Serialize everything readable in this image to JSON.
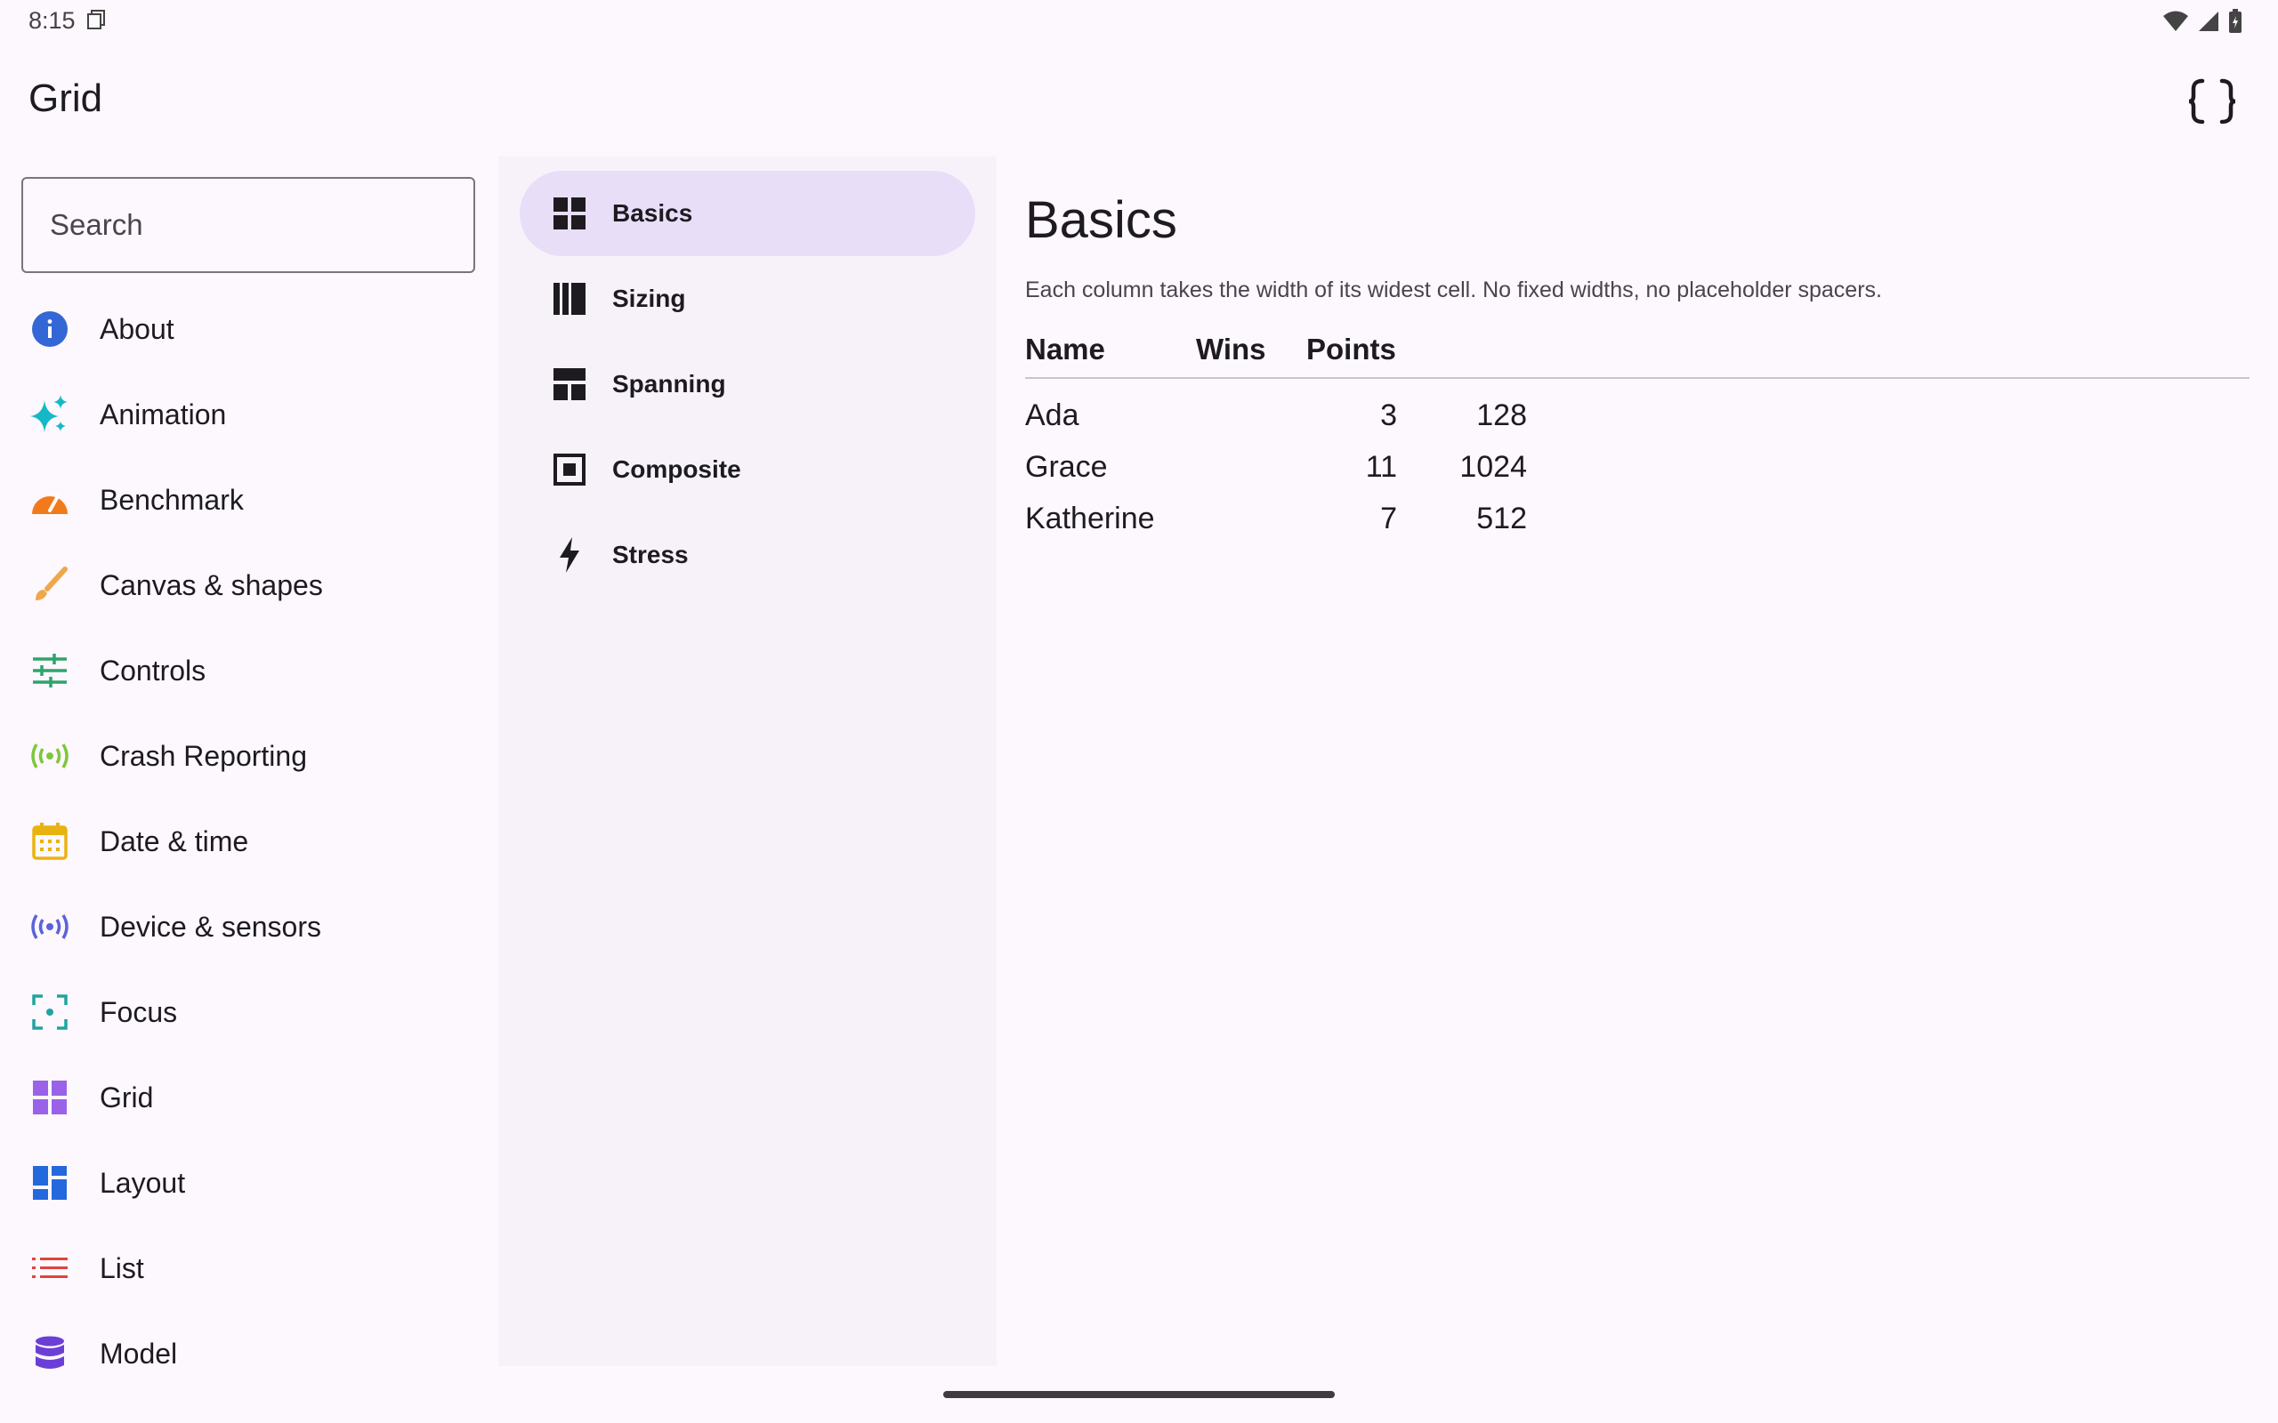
{
  "status": {
    "time": "8:15"
  },
  "app": {
    "title": "Grid"
  },
  "search": {
    "placeholder": "Search"
  },
  "nav": [
    {
      "label": "About",
      "icon": "info-icon",
      "color": "#3367d6"
    },
    {
      "label": "Animation",
      "icon": "sparkle-icon",
      "color": "#14b8c6"
    },
    {
      "label": "Benchmark",
      "icon": "speedometer-icon",
      "color": "#f27a1a"
    },
    {
      "label": "Canvas & shapes",
      "icon": "brush-icon",
      "color": "#eea84a"
    },
    {
      "label": "Controls",
      "icon": "sliders-icon",
      "color": "#2ea46b"
    },
    {
      "label": "Crash Reporting",
      "icon": "broadcast-icon",
      "color": "#7cc83a"
    },
    {
      "label": "Date & time",
      "icon": "calendar-icon",
      "color": "#e9b30f"
    },
    {
      "label": "Device & sensors",
      "icon": "sensors-icon",
      "color": "#5a63d8"
    },
    {
      "label": "Focus",
      "icon": "focus-icon",
      "color": "#1fa4a0"
    },
    {
      "label": "Grid",
      "icon": "grid-icon",
      "color": "#9a62e8"
    },
    {
      "label": "Layout",
      "icon": "dashboard-icon",
      "color": "#2468dd"
    },
    {
      "label": "List",
      "icon": "list-icon",
      "color": "#e0443a"
    },
    {
      "label": "Model",
      "icon": "database-icon",
      "color": "#6b3fd6"
    }
  ],
  "sub_nav": [
    {
      "label": "Basics",
      "icon": "grid-view-icon",
      "active": true
    },
    {
      "label": "Sizing",
      "icon": "columns-icon",
      "active": false
    },
    {
      "label": "Spanning",
      "icon": "span-layout-icon",
      "active": false
    },
    {
      "label": "Composite",
      "icon": "framed-square-icon",
      "active": false
    },
    {
      "label": "Stress",
      "icon": "bolt-icon",
      "active": false
    }
  ],
  "content": {
    "title": "Basics",
    "description": "Each column takes the width of its widest cell. No fixed widths, no placeholder spacers.",
    "table": {
      "headers": [
        "Name",
        "Wins",
        "Points"
      ],
      "rows": [
        [
          "Ada",
          "3",
          "128"
        ],
        [
          "Grace",
          "11",
          "1024"
        ],
        [
          "Katherine",
          "7",
          "512"
        ]
      ]
    }
  },
  "colors": {
    "accent_pill": "#e8def8",
    "pane_bg": "#f7f2fa",
    "background": "#fdf7fe"
  }
}
